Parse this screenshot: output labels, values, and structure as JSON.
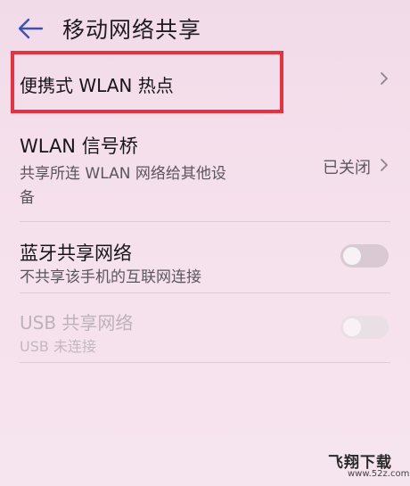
{
  "header": {
    "title": "移动网络共享",
    "back_icon": "arrow-left-icon"
  },
  "hotspot": {
    "label": "便携式 WLAN 热点",
    "highlight_color": "#e8303f"
  },
  "wlan_bridge": {
    "title": "WLAN 信号桥",
    "subtitle_line1": "共享所连 WLAN 网络给其他设",
    "subtitle_line2": "备",
    "status": "已关闭"
  },
  "bluetooth": {
    "title": "蓝牙共享网络",
    "subtitle": "不共享该手机的互联网连接",
    "enabled": false
  },
  "usb": {
    "title": "USB 共享网络",
    "subtitle": "USB 未连接",
    "enabled": false,
    "disabled": true
  },
  "watermark": {
    "text": "飞翔下载",
    "url": "www.52z.com"
  },
  "colors": {
    "accent": "#3d4fb8",
    "highlight": "#e8303f"
  }
}
